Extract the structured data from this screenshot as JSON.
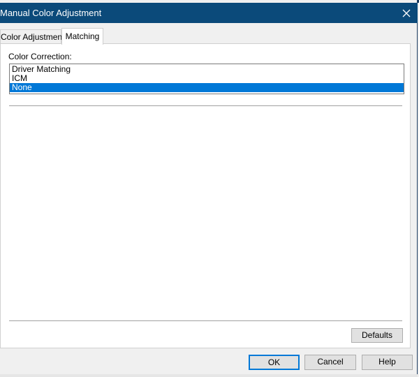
{
  "window": {
    "title": "Manual Color Adjustment"
  },
  "tabs": [
    {
      "label": "Color Adjustment",
      "selected": false
    },
    {
      "label": "Matching",
      "selected": true
    }
  ],
  "matching": {
    "color_correction_label": "Color Correction:",
    "options": [
      {
        "label": "Driver Matching",
        "selected": false
      },
      {
        "label": "ICM",
        "selected": false
      },
      {
        "label": "None",
        "selected": true
      }
    ],
    "defaults_label": "Defaults"
  },
  "footer": {
    "ok_label": "OK",
    "cancel_label": "Cancel",
    "help_label": "Help"
  },
  "icons": {
    "close": "close-icon"
  },
  "colors": {
    "titlebar": "#0b4a7a",
    "selection": "#0078d7",
    "default_button_border": "#0078d7"
  }
}
